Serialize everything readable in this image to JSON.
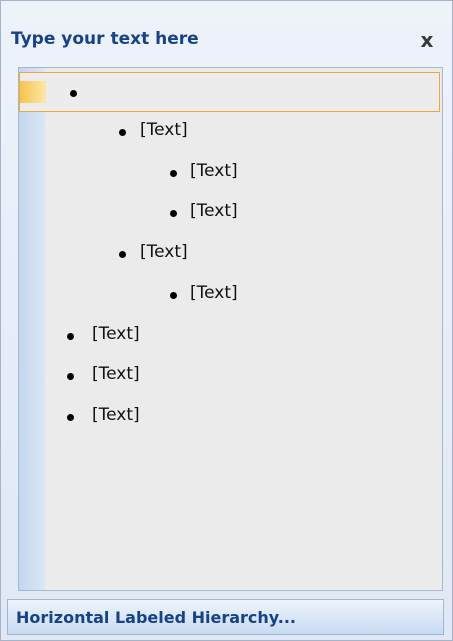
{
  "header": {
    "title": "Type your text here",
    "close_glyph": "x",
    "close_icon": "close-icon"
  },
  "items": [
    {
      "level": 1,
      "text": "",
      "selected": true
    },
    {
      "level": 2,
      "text": "[Text]"
    },
    {
      "level": 3,
      "text": "[Text]"
    },
    {
      "level": 3,
      "text": "[Text]"
    },
    {
      "level": 2,
      "text": "[Text]"
    },
    {
      "level": 3,
      "text": "[Text]"
    },
    {
      "level": 0,
      "text": "[Text]"
    },
    {
      "level": 0,
      "text": "[Text]"
    },
    {
      "level": 0,
      "text": "[Text]"
    }
  ],
  "footer": {
    "label": "Horizontal Labeled Hierarchy..."
  },
  "colors": {
    "accent": "#15428b",
    "selection_border": "#f0a73a"
  }
}
